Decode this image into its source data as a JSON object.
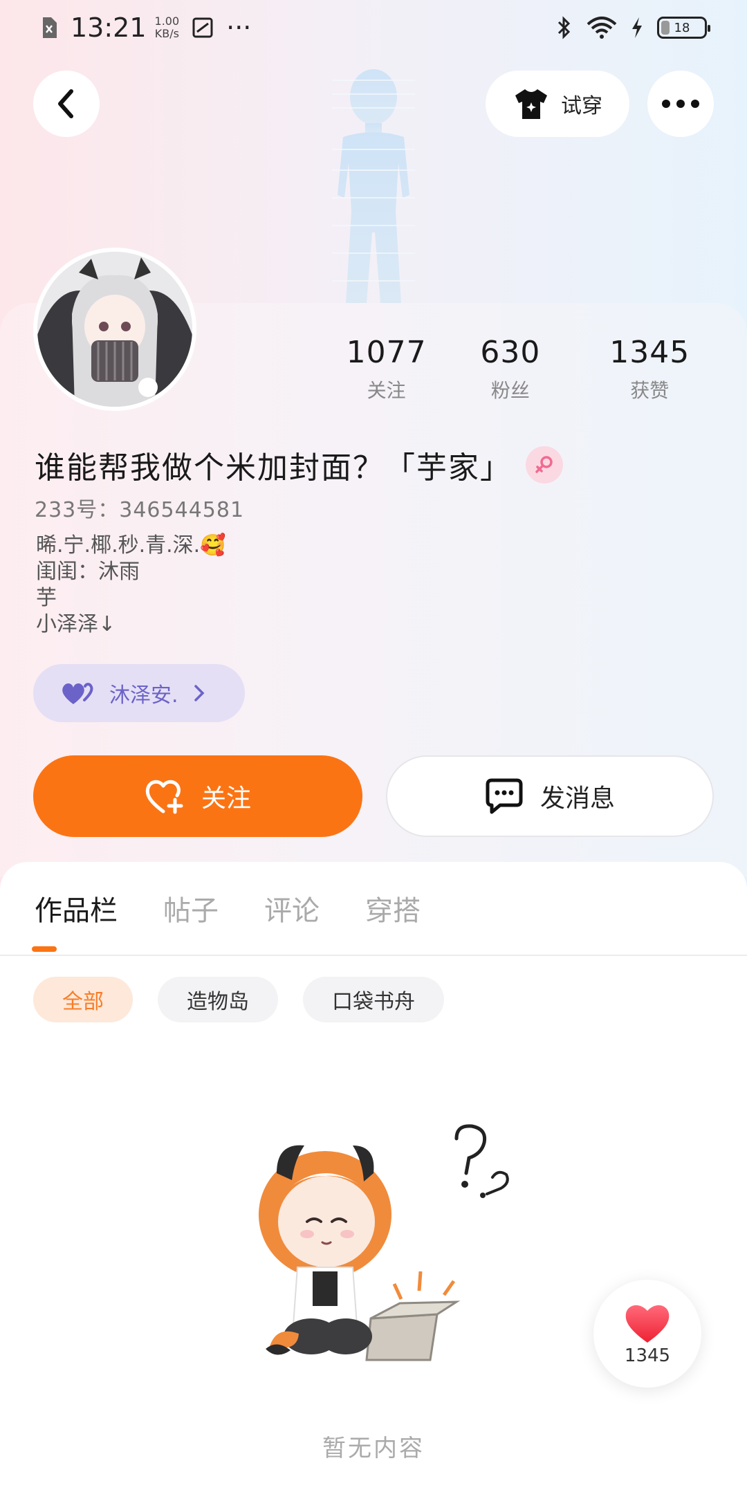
{
  "status_bar": {
    "time": "13:21",
    "speed_value": "1.00",
    "speed_unit": "KB/s",
    "more": "···",
    "battery": "18"
  },
  "header": {
    "tryon_label": "试穿"
  },
  "profile": {
    "stats": [
      {
        "value": "1077",
        "label": "关注"
      },
      {
        "value": "630",
        "label": "粉丝"
      },
      {
        "value": "1345",
        "label": "获赞"
      }
    ],
    "name": "谁能帮我做个米加封面？「芋家」",
    "uid": "233号：346544581",
    "bio_lines": [
      "晞.宁.椰.秒.青.深.🥰",
      "闺闺：沐雨",
      "芋",
      "小泽泽↓"
    ],
    "tag_chip_label": "沐泽安.",
    "follow_label": "关注",
    "message_label": "发消息"
  },
  "tabs": [
    "作品栏",
    "帖子",
    "评论",
    "穿搭"
  ],
  "filters": [
    "全部",
    "造物岛",
    "口袋书舟"
  ],
  "empty_text": "暂无内容",
  "like_count": "1345",
  "colors": {
    "accent": "#fb7414",
    "chip_active_bg": "#fde8da",
    "tag_chip_bg": "#e4dff5",
    "tag_chip_text": "#6b63c8",
    "gender_badge": "#f06b92"
  }
}
